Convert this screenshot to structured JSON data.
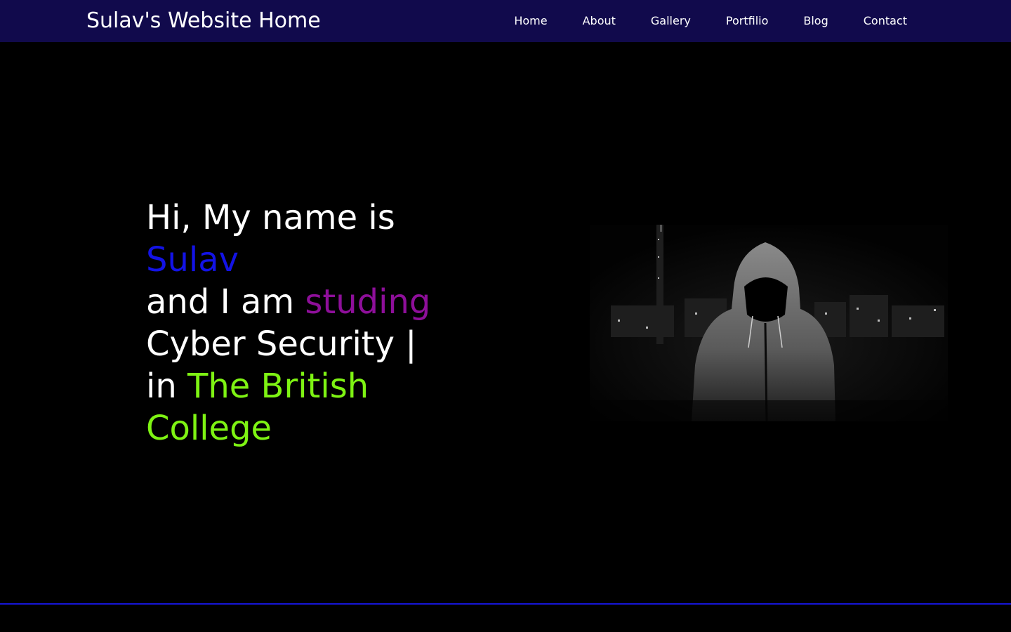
{
  "header": {
    "brand": "Sulav's Website Home",
    "nav": [
      "Home",
      "About",
      "Gallery",
      "Portfilio",
      "Blog",
      "Contact"
    ]
  },
  "hero": {
    "line1": "Hi, My name is",
    "name": "Sulav",
    "line3_prefix": "and I am ",
    "activity": "studing",
    "subject": "Cyber Security |",
    "line5_prefix": "in ",
    "college_part1": "The British",
    "college_part2": "College"
  },
  "colors": {
    "navbar": "#110a4c",
    "background": "#000000",
    "name": "#1313e6",
    "activity": "#8e0f9a",
    "college": "#7ef313",
    "rule": "#1515d6"
  },
  "image": {
    "icon": "hooded-figure-icon"
  }
}
